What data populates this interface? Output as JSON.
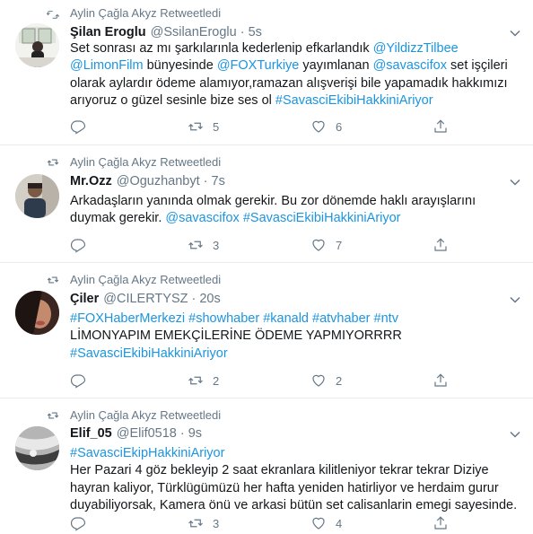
{
  "retweet_label": "Aylin Çağla Akyz Retweetledi",
  "tweets": [
    {
      "name": "Şilan Eroglu",
      "handle": "@SsilanEroglu",
      "time": "5s",
      "line1": {
        "t1": "Set sonrası az mı şarkılarınla kederlenip efkarlandık  ",
        "l1": "@YildizzTilbee"
      },
      "line2": {
        "l1": "@LimonFilm",
        "t1": " bünyesinde ",
        "l2": "@FOXTurkiye",
        "t2": " yayımlanan ",
        "l3": "@savascifox",
        "t3": " set işçileri"
      },
      "line3": "olarak aylardır ödeme alamıyor,ramazan alışverişi bile yapamadık hakkımızı",
      "line4": {
        "t1": "arıyoruz o güzel sesinle bize ses ol ",
        "l1": "#SavasciEkibiHakkiniAriyor"
      },
      "retweets": "5",
      "likes": "6"
    },
    {
      "name": "Mr.Ozz",
      "handle": "@Oguzhanbyt",
      "time": "7s",
      "line1": "Arkadaşların yanında olmak gerekir. Bu zor dönemde haklı arayışlarını",
      "line2": {
        "t1": "duymak gerekir. ",
        "l1": "@savascifox",
        "l2": "#SavasciEkibiHakkiniAriyor"
      },
      "retweets": "3",
      "likes": "7"
    },
    {
      "name": "Çiler",
      "handle": "@CILERTYSZ",
      "time": "20s",
      "line1": [
        "#FOXHaberMerkezi",
        "#showhaber",
        "#kanald",
        "#atvhaber",
        "#ntv"
      ],
      "line2": "LİMONYAPIM EMEKÇİLERİNE ÖDEME YAPMIYORRRR",
      "line3": "#SavasciEkibiHakkiniAriyor",
      "retweets": "2",
      "likes": "2"
    },
    {
      "name": "Elif_05",
      "handle": "@Elif0518",
      "time": "9s",
      "line1": "#SavasciEkipHakkiniAriyor",
      "line2": "Her Pazari 4 göz bekleyip 2 saat ekranlara kilitleniyor tekrar tekrar Diziye",
      "line3": "hayran kaliyor, Türklügümüzü her hafta yeniden hatirliyor ve herdaim gurur",
      "line4": "duyabiliyorsak, Kamera önü ve arkasi bütün set calisanlarin emegi sayesinde.",
      "retweets": "3",
      "likes": "4"
    }
  ]
}
